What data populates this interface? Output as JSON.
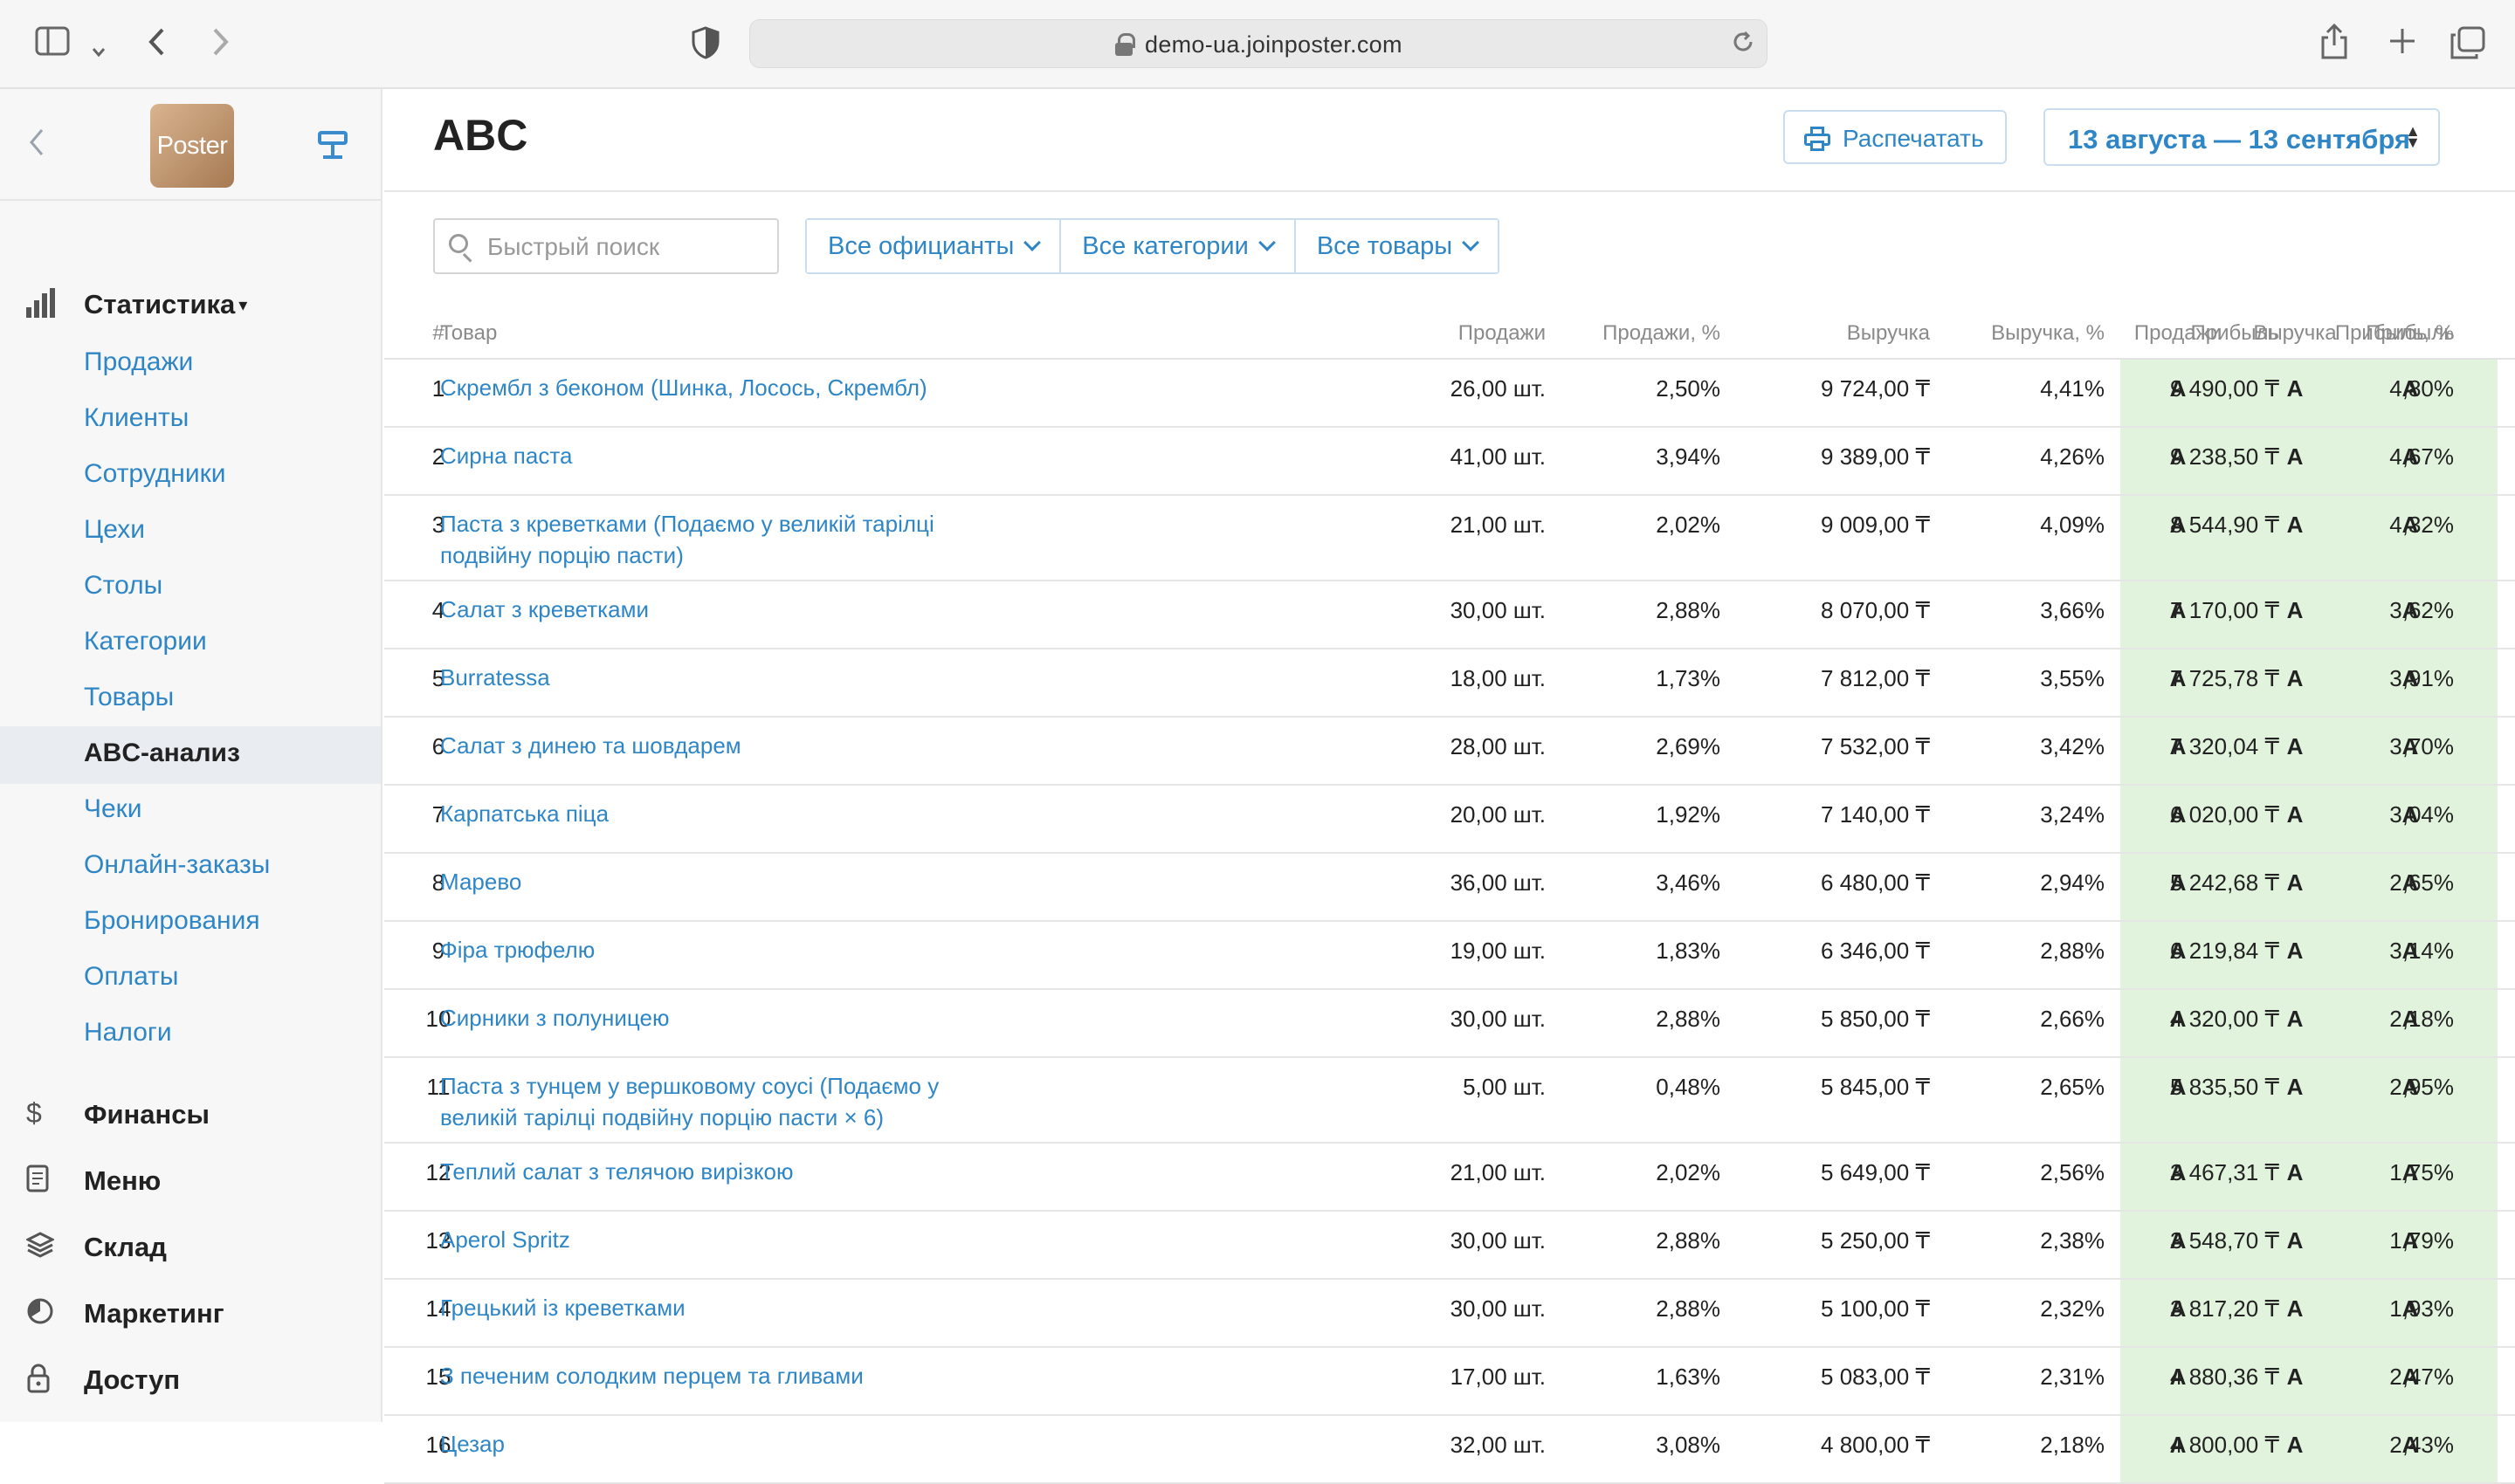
{
  "browser": {
    "url": "demo-ua.joinposter.com"
  },
  "sidebar": {
    "logo_text": "Poster",
    "sections": [
      {
        "label": "Статистика",
        "icon": "bar-chart-icon"
      },
      {
        "label": "Финансы",
        "icon": "dollar-icon"
      },
      {
        "label": "Меню",
        "icon": "document-icon"
      },
      {
        "label": "Склад",
        "icon": "layers-icon"
      },
      {
        "label": "Маркетинг",
        "icon": "tag-icon"
      },
      {
        "label": "Доступ",
        "icon": "lock-icon"
      }
    ],
    "stat_items": [
      "Продажи",
      "Клиенты",
      "Сотрудники",
      "Цехи",
      "Столы",
      "Категории",
      "Товары",
      "ABC-анализ",
      "Чеки",
      "Онлайн-заказы",
      "Бронирования",
      "Оплаты",
      "Налоги"
    ],
    "active_item": "ABC-анализ"
  },
  "main": {
    "title": "ABC",
    "print_label": "Распечатать",
    "date_range": "13 августа — 13 сентября",
    "search_placeholder": "Быстрый поиск",
    "filters": [
      "Все официанты",
      "Все категории",
      "Все товары"
    ]
  },
  "table": {
    "headers": [
      "#",
      "Товар",
      "Продажи",
      "Продажи, %",
      "Выручка",
      "Выручка, %",
      "Прибыль",
      "Прибыль, %",
      "Продажи",
      "Выручка",
      "Прибыль"
    ],
    "rows": [
      [
        "1",
        "Скрембл з беконом (Шинка, Лосось, Скрембл)",
        "26,00 шт.",
        "2,50%",
        "9 724,00 ₸",
        "4,41%",
        "9 490,00 ₸",
        "4,80%",
        "A",
        "A",
        "A"
      ],
      [
        "2",
        "Сирна паста",
        "41,00 шт.",
        "3,94%",
        "9 389,00 ₸",
        "4,26%",
        "9 238,50 ₸",
        "4,67%",
        "A",
        "A",
        "A"
      ],
      [
        "3",
        "Паста з креветками (Подаємо у великій тарілці подвійну порцію пасти)",
        "21,00 шт.",
        "2,02%",
        "9 009,00 ₸",
        "4,09%",
        "8 544,90 ₸",
        "4,32%",
        "A",
        "A",
        "A"
      ],
      [
        "4",
        "Салат з креветками",
        "30,00 шт.",
        "2,88%",
        "8 070,00 ₸",
        "3,66%",
        "7 170,00 ₸",
        "3,62%",
        "A",
        "A",
        "A"
      ],
      [
        "5",
        "Burratessa",
        "18,00 шт.",
        "1,73%",
        "7 812,00 ₸",
        "3,55%",
        "7 725,78 ₸",
        "3,91%",
        "A",
        "A",
        "A"
      ],
      [
        "6",
        "Салат з динею та шовдарем",
        "28,00 шт.",
        "2,69%",
        "7 532,00 ₸",
        "3,42%",
        "7 320,04 ₸",
        "3,70%",
        "A",
        "A",
        "A"
      ],
      [
        "7",
        "Карпатська піца",
        "20,00 шт.",
        "1,92%",
        "7 140,00 ₸",
        "3,24%",
        "6 020,00 ₸",
        "3,04%",
        "A",
        "A",
        "A"
      ],
      [
        "8",
        "Марево",
        "36,00 шт.",
        "3,46%",
        "6 480,00 ₸",
        "2,94%",
        "5 242,68 ₸",
        "2,65%",
        "A",
        "A",
        "A"
      ],
      [
        "9",
        "Фіра трюфелю",
        "19,00 шт.",
        "1,83%",
        "6 346,00 ₸",
        "2,88%",
        "6 219,84 ₸",
        "3,14%",
        "A",
        "A",
        "A"
      ],
      [
        "10",
        "Сирники з полуницею",
        "30,00 шт.",
        "2,88%",
        "5 850,00 ₸",
        "2,66%",
        "4 320,00 ₸",
        "2,18%",
        "A",
        "A",
        "A"
      ],
      [
        "11",
        "Паста з тунцем у вершковому соусі (Подаємо у великій тарілці подвійну порцію пасти × 6)",
        "5,00 шт.",
        "0,48%",
        "5 845,00 ₸",
        "2,65%",
        "5 835,50 ₸",
        "2,95%",
        "A",
        "A",
        "A"
      ],
      [
        "12",
        "Теплий салат з телячою вирізкою",
        "21,00 шт.",
        "2,02%",
        "5 649,00 ₸",
        "2,56%",
        "3 467,31 ₸",
        "1,75%",
        "A",
        "A",
        "A"
      ],
      [
        "13",
        "Aperol Spritz",
        "30,00 шт.",
        "2,88%",
        "5 250,00 ₸",
        "2,38%",
        "3 548,70 ₸",
        "1,79%",
        "A",
        "A",
        "A"
      ],
      [
        "14",
        "Грецький із креветками",
        "30,00 шт.",
        "2,88%",
        "5 100,00 ₸",
        "2,32%",
        "3 817,20 ₸",
        "1,93%",
        "A",
        "A",
        "A"
      ],
      [
        "15",
        "З печеним солодким перцем та гливами",
        "17,00 шт.",
        "1,63%",
        "5 083,00 ₸",
        "2,31%",
        "4 880,36 ₸",
        "2,47%",
        "A",
        "A",
        "A"
      ],
      [
        "16",
        "Цезар",
        "32,00 шт.",
        "3,08%",
        "4 800,00 ₸",
        "2,18%",
        "4 800,00 ₸",
        "2,43%",
        "A",
        "A",
        "A"
      ]
    ]
  }
}
